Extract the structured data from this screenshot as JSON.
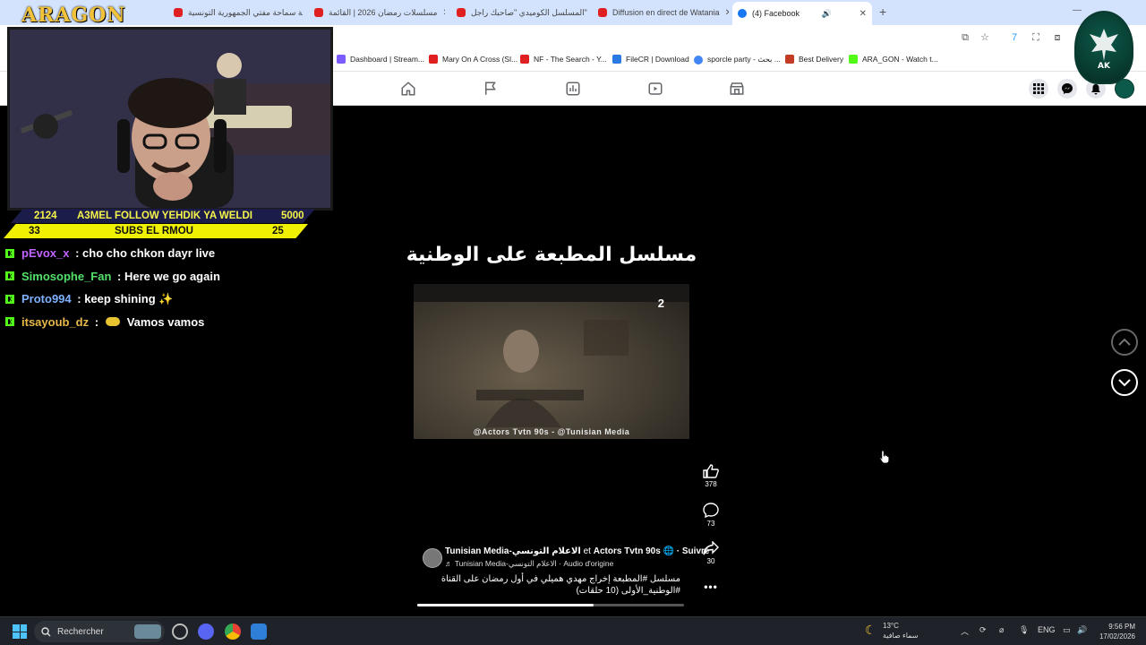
{
  "stream": {
    "logo": "ARAGON",
    "stats": {
      "follow_count": "2124",
      "follow_text": "A3MEL FOLLOW YEHDIK YA WELDI",
      "follow_goal": "5000",
      "subs_count": "33",
      "subs_text": "SUBS EL RMOU",
      "subs_goal": "25"
    },
    "chat": [
      {
        "user": "pEvox_x",
        "color": "#c064ff",
        "sep": " : ",
        "msg": "cho cho chkon dayr live"
      },
      {
        "user": "Simosophe_Fan",
        "color": "#53e069",
        "sep": " : ",
        "msg": "Here we go again"
      },
      {
        "user": "Proto994",
        "color": "#7fb1ff",
        "sep": " : ",
        "msg": "keep shining ✨"
      },
      {
        "user": "itsayoub_dz",
        "color": "#e8b84a",
        "sep": " : ",
        "msg": "Vamos vamos"
      }
    ]
  },
  "browser": {
    "tabs": [
      {
        "label": "كلمة سماحة مفتي الجمهورية التونسية",
        "icon": "yt"
      },
      {
        "label": "مسلسلات رمضان 2026 | القائمة",
        "icon": "yt"
      },
      {
        "label": "المسلسل الكوميدي \"صاحبك راجل\"",
        "icon": "yt"
      },
      {
        "label": "Diffusion en direct de Watania",
        "icon": "yt"
      },
      {
        "label": "(4) Facebook",
        "icon": "fb"
      }
    ],
    "bookmarks": [
      {
        "label": "Dashboard | Stream...",
        "color": "#7b5cff"
      },
      {
        "label": "Mary On A Cross (Sl...",
        "color": "#e02020"
      },
      {
        "label": "NF - The Search - Y...",
        "color": "#e02020"
      },
      {
        "label": "FileCR | Download",
        "color": "#2a7ae2"
      },
      {
        "label": "sporcle party - بحث ...",
        "color": "#4285f4"
      },
      {
        "label": "Best Delivery",
        "color": "#c23b22"
      },
      {
        "label": "ARA_GON - Watch t...",
        "color": "#53fc18"
      }
    ]
  },
  "reel": {
    "title": "مسلسل المطبعة على الوطنية",
    "watermark": "@Actors Tvtn 90s - @Tunisian Media",
    "channel_logo": "2",
    "likes": "378",
    "comments": "73",
    "shares": "30",
    "author_1": "Tunisian Media-الاعلام التونسي",
    "author_join": " et ",
    "author_2": "Actors Tvtn 90s",
    "follow": "· Suivre",
    "audio": "♬ Tunisian Media-الاعلام التونسي · Audio d'origine",
    "caption": "مسلسل #المطبعة إخراج مهدي هميلي في أول رمضان على القناة #الوطنية_الأولى (10 حلقات)",
    "progress": 0.66
  },
  "taskbar": {
    "search_placeholder": "Rechercher",
    "weather_temp": "13°C",
    "weather_desc": "سماء صافية",
    "lang": "ENG",
    "time": "9:56 PM",
    "date": "17/02/2026"
  },
  "colors": {
    "accent_kick": "#53fc18",
    "stat_yellow": "#f0f002",
    "fb_blue": "#1877f2"
  }
}
